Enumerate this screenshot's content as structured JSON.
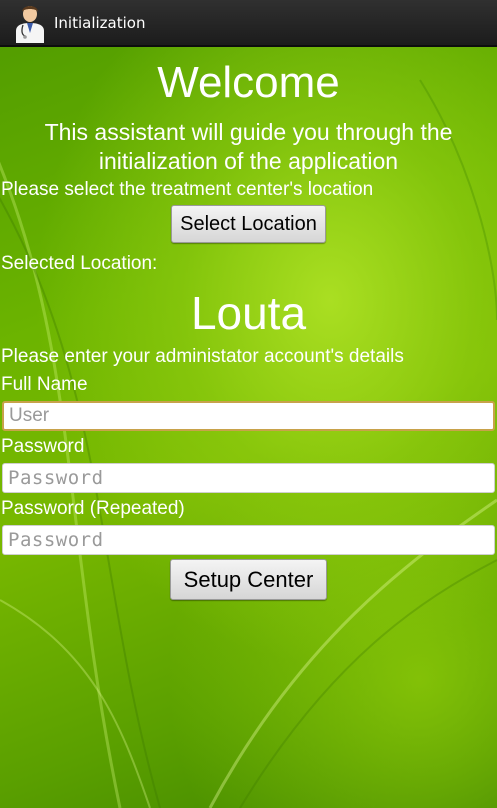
{
  "action_bar": {
    "title": "Initialization",
    "icon": "doctor-avatar-icon"
  },
  "main": {
    "heading": "Welcome",
    "intro_line1": "This assistant will guide you through the",
    "intro_line2": "initialization of the application",
    "select_location_prompt": "Please select the treatment center's location",
    "select_location_button": "Select Location",
    "selected_location_label": "Selected Location:",
    "selected_location_value": "Louta",
    "admin_prompt": "Please enter your administator account's details",
    "full_name_label": "Full Name",
    "full_name_placeholder": "User",
    "password_label": "Password",
    "password_placeholder": "Password",
    "password_repeat_label": "Password (Repeated)",
    "password_repeat_placeholder": "Password",
    "setup_button": "Setup Center"
  },
  "colors": {
    "background_green": "#6cb400",
    "action_bar": "#262626",
    "focus_border": "#c8a24a"
  }
}
